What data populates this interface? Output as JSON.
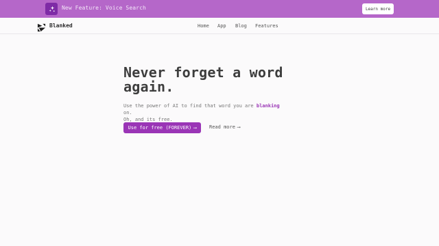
{
  "banner": {
    "icon": "sparkle-icon",
    "text": "New Feature: Voice Search",
    "button_label": "Learn more"
  },
  "nav": {
    "logo_icon": "blanked-logo-icon",
    "brand": "Blanked",
    "links": [
      "Home",
      "App",
      "Blog",
      "Features"
    ]
  },
  "hero": {
    "headline_line1": "Never forget a word",
    "headline_line2": "again.",
    "sub_part1": "Use the power of AI to find that word you are ",
    "sub_highlight": "blanking",
    "sub_part2": " on.",
    "sub_line2": "Oh, and its free.",
    "primary_label": "Use for free (FOREVER)",
    "primary_arrow": "⟶",
    "secondary_label": "Read more",
    "secondary_arrow": "⟶"
  },
  "colors": {
    "banner_bg": "#b567c9",
    "banner_icon_bg": "#7e2ba6",
    "accent": "#9a35b6",
    "page_bg": "#fbfafb"
  }
}
